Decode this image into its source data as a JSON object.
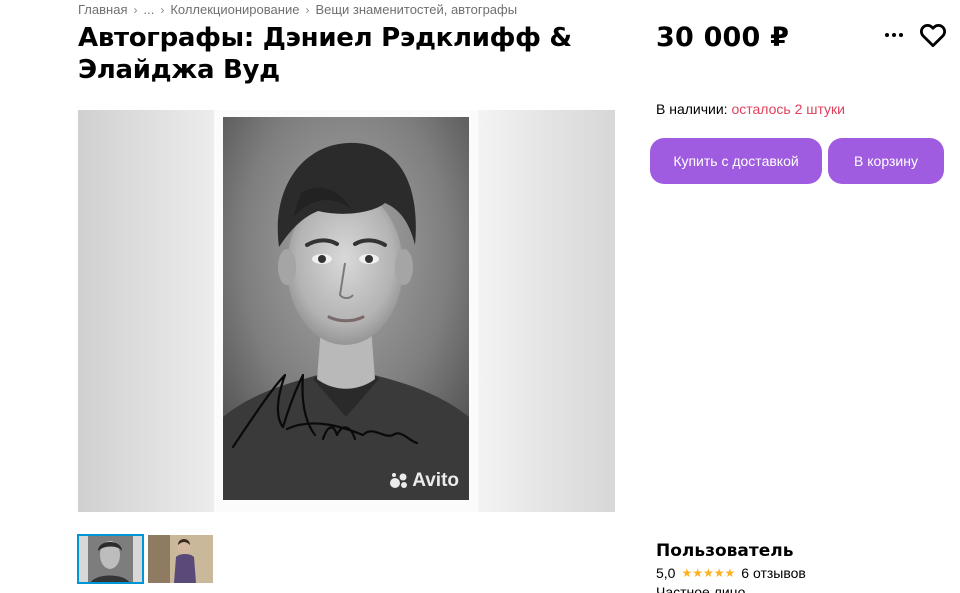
{
  "breadcrumb": {
    "items": [
      "Главная",
      "...",
      "Коллекционирование",
      "Вещи знаменитостей, автографы"
    ]
  },
  "listing": {
    "title": "Автографы: Дэниел Рэдклифф & Элайджа Вуд",
    "price": "30 000 ₽",
    "stock_label": "В наличии:",
    "stock_value": "осталось 2 штуки"
  },
  "actions": {
    "buy_label": "Купить с доставкой",
    "cart_label": "В корзину"
  },
  "gallery": {
    "watermark": "Avito"
  },
  "seller": {
    "name": "Пользователь",
    "rating": "5,0",
    "reviews": "6 отзывов",
    "type": "Частное лицо"
  },
  "colors": {
    "accent": "#9f5ce0",
    "stock_highlight": "#e0405c",
    "star": "#ffb021",
    "thumb_active": "#0096d6"
  }
}
